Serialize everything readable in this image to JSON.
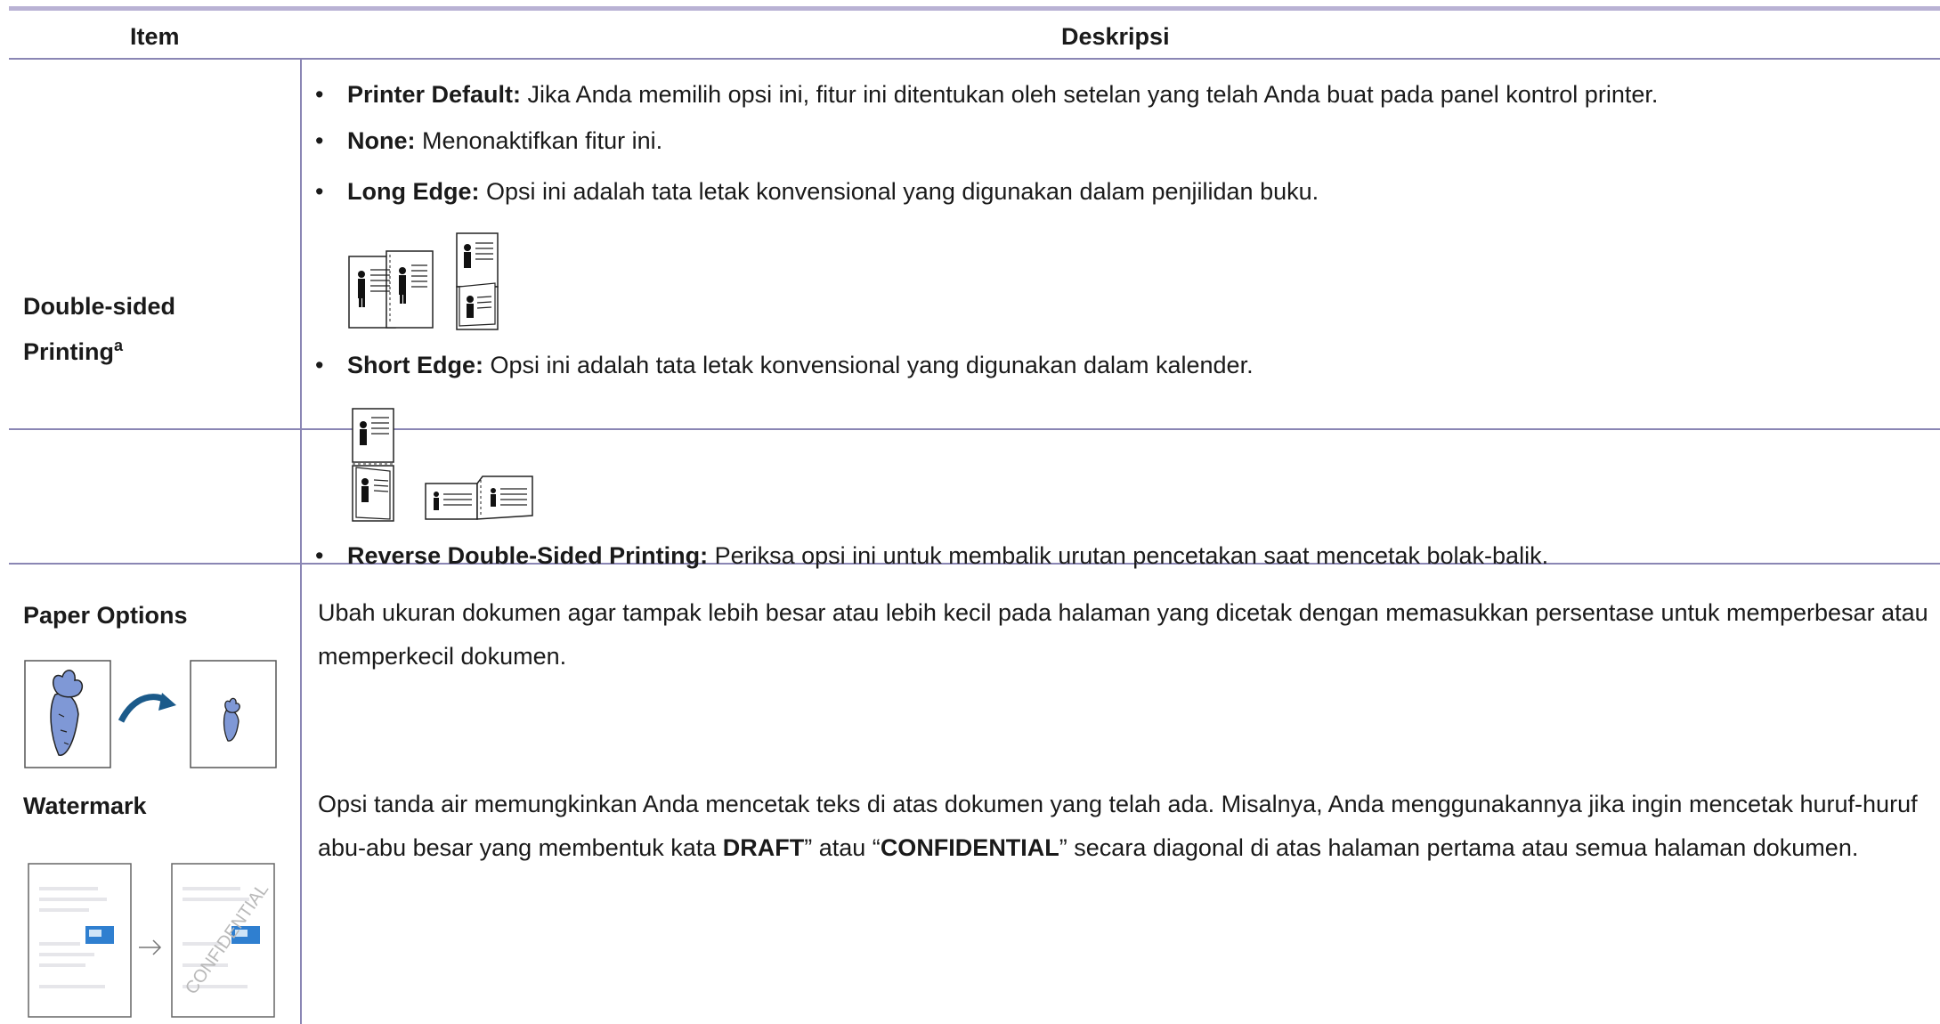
{
  "table": {
    "headers": {
      "item": "Item",
      "description": "Deskripsi"
    },
    "rows": {
      "double_sided": {
        "label": "Double-sided Printing",
        "footnote_mark": "a",
        "options": [
          {
            "term": "Printer Default:",
            "text": " Jika Anda memilih opsi ini, fitur ini ditentukan oleh setelan yang telah Anda buat pada panel kontrol printer."
          },
          {
            "term": "None:",
            "text": " Menonaktifkan fitur ini."
          },
          {
            "term": "Long Edge:",
            "text": " Opsi ini adalah tata letak konvensional yang digunakan dalam penjilidan buku."
          },
          {
            "term": "Short Edge:",
            "text": " Opsi ini adalah tata letak konvensional yang digunakan dalam kalender."
          },
          {
            "term": "Reverse Double-Sided Printing:",
            "text": " Periksa opsi ini untuk membalik urutan pencetakan saat mencetak bolak-balik."
          }
        ]
      },
      "paper_options": {
        "label": "Paper Options",
        "description": "Ubah ukuran dokumen agar tampak lebih besar atau lebih kecil pada halaman yang dicetak dengan memasukkan persentase untuk memperbesar atau memperkecil dokumen."
      },
      "watermark": {
        "label": "Watermark",
        "desc_part1": "Opsi tanda air memungkinkan Anda mencetak teks di atas dokumen yang telah ada. Misalnya, Anda menggunakannya jika ingin mencetak huruf-huruf abu-abu besar yang membentuk kata ",
        "bold1": "DRAFT",
        "desc_part2": "” atau “",
        "bold2": "CONFIDENTIAL",
        "desc_part3": "” secara diagonal di atas halaman pertama atau semua halaman dokumen.",
        "stamp_text": "CONFIDENTIAL"
      }
    }
  },
  "colors": {
    "rule": "#8a86b4",
    "top_rule": "#b9b2d4",
    "arrow": "#1b5a8a",
    "carrot": "#7f98d6"
  },
  "icons": [
    "binding-long-edge-icon",
    "binding-short-edge-icon",
    "resize-carrot-icon",
    "watermark-icon"
  ]
}
